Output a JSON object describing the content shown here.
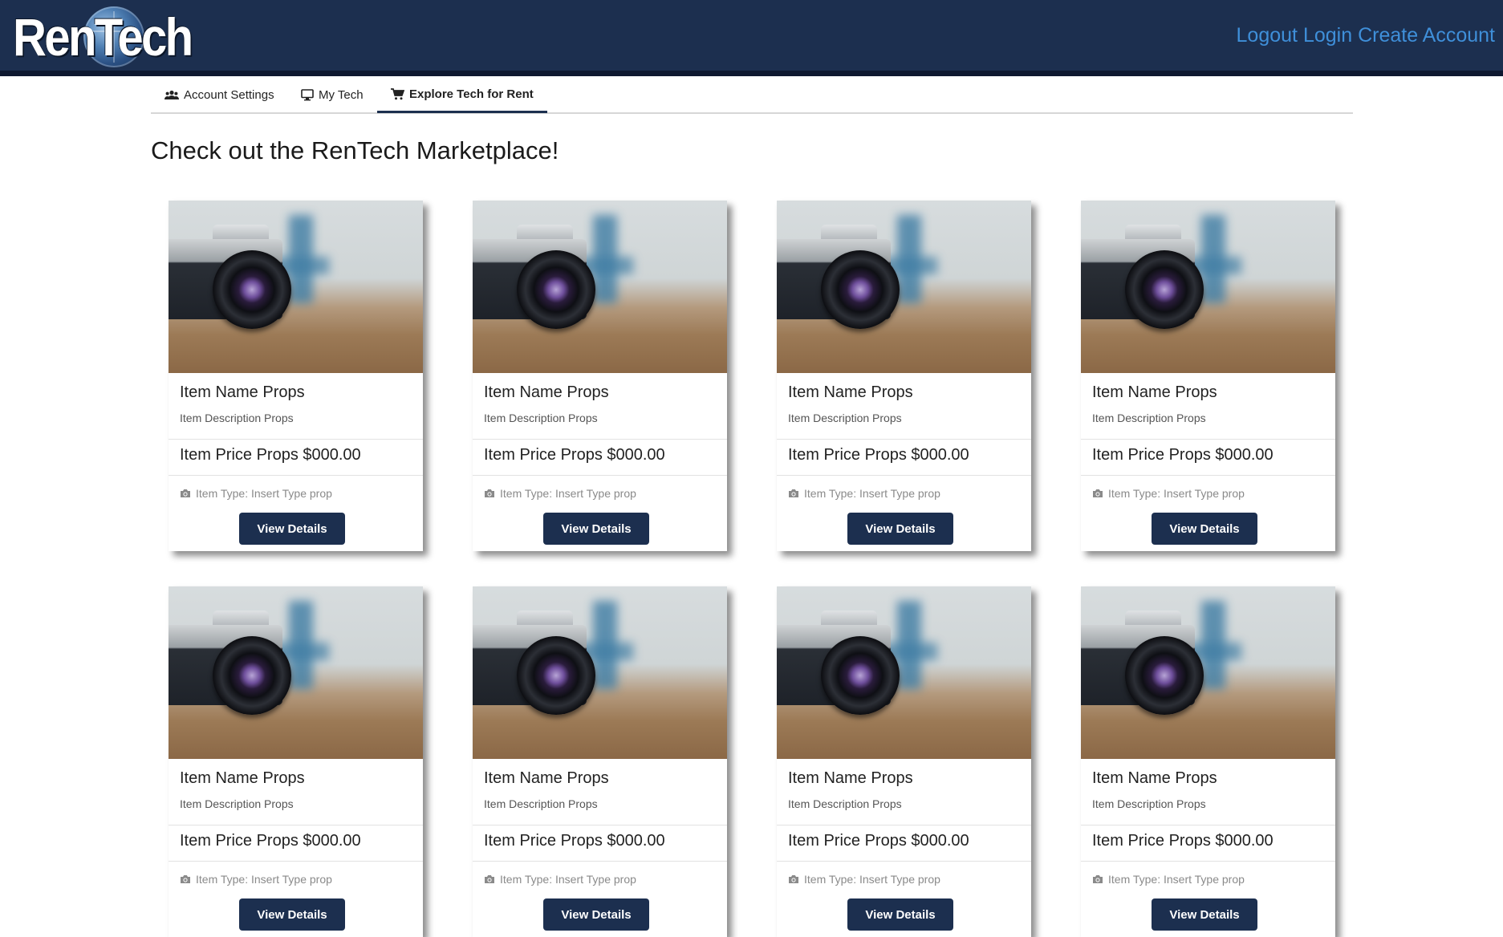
{
  "header": {
    "logo_text": "RenTech",
    "links": [
      "Logout",
      "Login",
      "Create Account"
    ]
  },
  "tabs": [
    {
      "label": "Account Settings",
      "icon": "users-icon",
      "active": false
    },
    {
      "label": "My Tech",
      "icon": "monitor-icon",
      "active": false
    },
    {
      "label": "Explore Tech for Rent",
      "icon": "cart-icon",
      "active": true
    }
  ],
  "page_title": "Check out the RenTech Marketplace!",
  "cards": [
    {
      "name": "Item Name Props",
      "description": "Item Description Props",
      "price": "Item Price Props $000.00",
      "type": "Item Type: Insert Type prop",
      "button": "View Details",
      "icon": "camera-icon"
    },
    {
      "name": "Item Name Props",
      "description": "Item Description Props",
      "price": "Item Price Props $000.00",
      "type": "Item Type: Insert Type prop",
      "button": "View Details",
      "icon": "camera-icon"
    },
    {
      "name": "Item Name Props",
      "description": "Item Description Props",
      "price": "Item Price Props $000.00",
      "type": "Item Type: Insert Type prop",
      "button": "View Details",
      "icon": "camera-icon"
    },
    {
      "name": "Item Name Props",
      "description": "Item Description Props",
      "price": "Item Price Props $000.00",
      "type": "Item Type: Insert Type prop",
      "button": "View Details",
      "icon": "camera-icon"
    },
    {
      "name": "Item Name Props",
      "description": "Item Description Props",
      "price": "Item Price Props $000.00",
      "type": "Item Type: Insert Type prop",
      "button": "View Details",
      "icon": "camera-icon"
    },
    {
      "name": "Item Name Props",
      "description": "Item Description Props",
      "price": "Item Price Props $000.00",
      "type": "Item Type: Insert Type prop",
      "button": "View Details",
      "icon": "camera-icon"
    },
    {
      "name": "Item Name Props",
      "description": "Item Description Props",
      "price": "Item Price Props $000.00",
      "type": "Item Type: Insert Type prop",
      "button": "View Details",
      "icon": "camera-icon"
    },
    {
      "name": "Item Name Props",
      "description": "Item Description Props",
      "price": "Item Price Props $000.00",
      "type": "Item Type: Insert Type prop",
      "button": "View Details",
      "icon": "camera-icon"
    }
  ],
  "colors": {
    "header_bg": "#1c2f4f",
    "link": "#3f8fd9",
    "button_bg": "#1c2f4f"
  }
}
